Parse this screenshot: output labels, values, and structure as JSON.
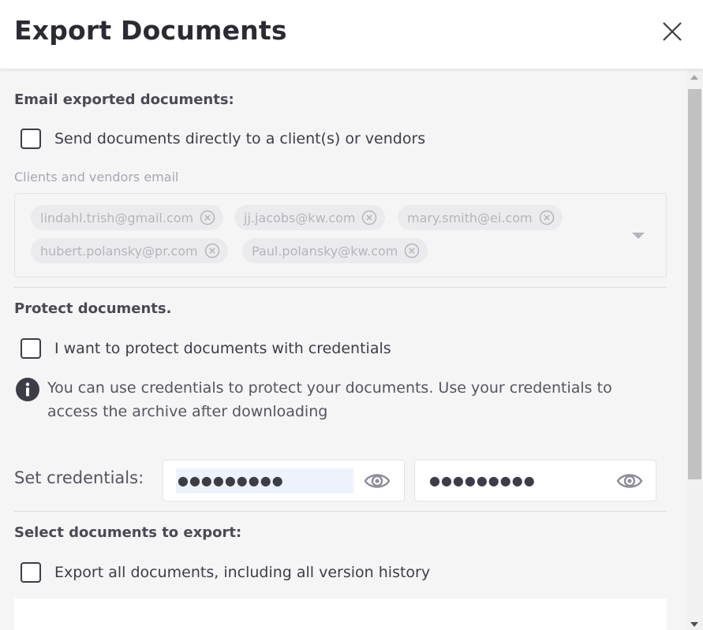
{
  "dialog": {
    "title": "Export Documents"
  },
  "email_section": {
    "title": "Email exported documents:",
    "checkbox_label": "Send documents directly to a client(s) or vendors",
    "field_label": "Clients and vendors email",
    "emails": [
      "lindahl.trish@gmail.com",
      "jj.jacobs@kw.com",
      "mary.smith@ei.com",
      "hubert.polansky@pr.com",
      "Paul.polansky@kw.com"
    ]
  },
  "protect_section": {
    "title": "Protect documents.",
    "checkbox_label": "I want to protect documents with credentials",
    "info_text": "You can use credentials to protect your documents. Use your credentials to access the archive after downloading",
    "credentials_label": "Set credentials:",
    "credential_1": "●●●●●●●●●",
    "credential_2": "●●●●●●●●●"
  },
  "select_section": {
    "title": "Select documents to export:",
    "checkbox_label": "Export all documents, including all version history"
  },
  "colors": {
    "text": "#3d3d47",
    "muted": "#a7a7b1",
    "chip_bg": "#ebebee",
    "panel_bg": "#f5f5f6"
  },
  "icons": [
    "close-icon",
    "remove-chip-icon",
    "chevron-down-icon",
    "info-icon",
    "eye-icon"
  ]
}
